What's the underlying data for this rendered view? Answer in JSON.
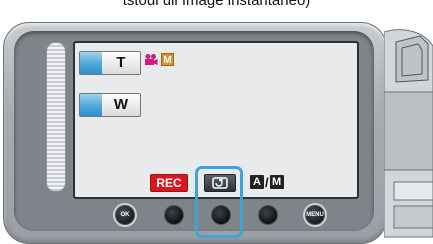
{
  "caption": "tstoul ull Image instantaneo)",
  "screen": {
    "zoom_tele_label": "T",
    "zoom_wide_label": "W",
    "mode_icons": [
      "movie-camera-icon",
      "manual-m-icon"
    ],
    "manual_mode_letter": "M",
    "rec_label": "REC",
    "auto_manual": {
      "auto": "A",
      "separator": "/",
      "manual": "M"
    }
  },
  "touch_buttons": {
    "ok_label": "OK",
    "menu_label": "MENU"
  },
  "colors": {
    "highlight": "#3fa3d9",
    "rec": "#d9161f",
    "zoom_accent": "#4ea7d8",
    "mode_icon": "#d9902f"
  }
}
